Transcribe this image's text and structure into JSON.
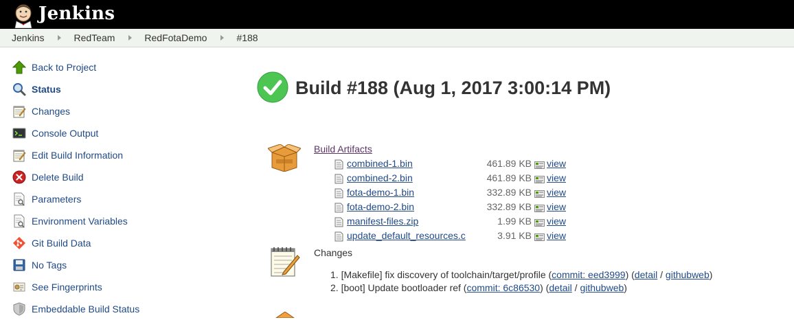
{
  "header": {
    "brand": "Jenkins"
  },
  "breadcrumb": [
    "Jenkins",
    "RedTeam",
    "RedFotaDemo",
    "#188"
  ],
  "sidebar": {
    "items": [
      {
        "label": "Back to Project",
        "icon": "up-arrow-icon"
      },
      {
        "label": "Status",
        "icon": "magnifier-icon"
      },
      {
        "label": "Changes",
        "icon": "notepad-icon"
      },
      {
        "label": "Console Output",
        "icon": "terminal-icon"
      },
      {
        "label": "Edit Build Information",
        "icon": "notepad-icon"
      },
      {
        "label": "Delete Build",
        "icon": "red-x-icon"
      },
      {
        "label": "Parameters",
        "icon": "document-magnifier-icon"
      },
      {
        "label": "Environment Variables",
        "icon": "document-magnifier-icon"
      },
      {
        "label": "Git Build Data",
        "icon": "git-icon"
      },
      {
        "label": "No Tags",
        "icon": "floppy-disk-icon"
      },
      {
        "label": "See Fingerprints",
        "icon": "fingerprint-icon"
      },
      {
        "label": "Embeddable Build Status",
        "icon": "shield-icon"
      }
    ]
  },
  "build": {
    "title": "Build #188 (Aug 1, 2017 3:00:14 PM)",
    "status_color": "#4cc552"
  },
  "artifacts": {
    "title": "Build Artifacts",
    "view_label": "view",
    "items": [
      {
        "name": "combined-1.bin",
        "size": "461.89 KB"
      },
      {
        "name": "combined-2.bin",
        "size": "461.89 KB"
      },
      {
        "name": "fota-demo-1.bin",
        "size": "332.89 KB"
      },
      {
        "name": "fota-demo-2.bin",
        "size": "332.89 KB"
      },
      {
        "name": "manifest-files.zip",
        "size": "1.99 KB"
      },
      {
        "name": "update_default_resources.c",
        "size": "3.91 KB"
      }
    ]
  },
  "changes": {
    "title": "Changes",
    "items": [
      {
        "num": "1.",
        "text": "[Makefile] fix discovery of toolchain/target/profile (",
        "commit": "commit: eed3999",
        "mid": ") (",
        "detail": "detail",
        "sep": " / ",
        "web": "githubweb",
        "end": ")"
      },
      {
        "num": "2.",
        "text": "[boot] Update bootloader ref (",
        "commit": "commit: 6c86530",
        "mid": ") (",
        "detail": "detail",
        "sep": " / ",
        "web": "githubweb",
        "end": ")"
      }
    ]
  }
}
